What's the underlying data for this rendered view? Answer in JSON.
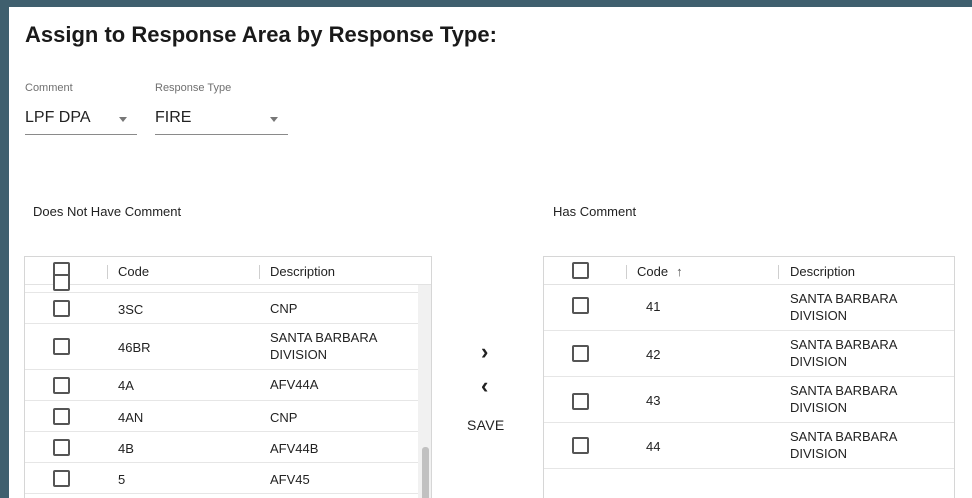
{
  "title": "Assign to Response Area by Response Type:",
  "filters": {
    "comment": {
      "label": "Comment",
      "value": "LPF DPA"
    },
    "response_type": {
      "label": "Response Type",
      "value": "FIRE"
    }
  },
  "left_grid": {
    "section_label": "Does Not Have Comment",
    "headers": {
      "code": "Code",
      "description": "Description"
    },
    "rows": [
      {
        "code": "3SC",
        "description_line1": "CNP",
        "description_line2": ""
      },
      {
        "code": "46BR",
        "description_line1": "SANTA BARBARA",
        "description_line2": "DIVISION"
      },
      {
        "code": "4A",
        "description_line1": "AFV44A",
        "description_line2": ""
      },
      {
        "code": "4AN",
        "description_line1": "CNP",
        "description_line2": ""
      },
      {
        "code": "4B",
        "description_line1": "AFV44B",
        "description_line2": ""
      },
      {
        "code": "5",
        "description_line1": "AFV45",
        "description_line2": ""
      }
    ]
  },
  "right_grid": {
    "section_label": "Has Comment",
    "headers": {
      "code": "Code",
      "description": "Description"
    },
    "sort_icon": "arrow-up-icon",
    "rows": [
      {
        "code": "41",
        "description_line1": "SANTA BARBARA",
        "description_line2": "DIVISION"
      },
      {
        "code": "42",
        "description_line1": "SANTA BARBARA",
        "description_line2": "DIVISION"
      },
      {
        "code": "43",
        "description_line1": "SANTA BARBARA",
        "description_line2": "DIVISION"
      },
      {
        "code": "44",
        "description_line1": "SANTA BARBARA",
        "description_line2": "DIVISION"
      }
    ]
  },
  "actions": {
    "move_right": "›",
    "move_left": "‹",
    "save": "SAVE"
  },
  "colors": {
    "frame": "#3f5f6e",
    "panel": "#ffffff",
    "border": "#d6d6d6"
  }
}
